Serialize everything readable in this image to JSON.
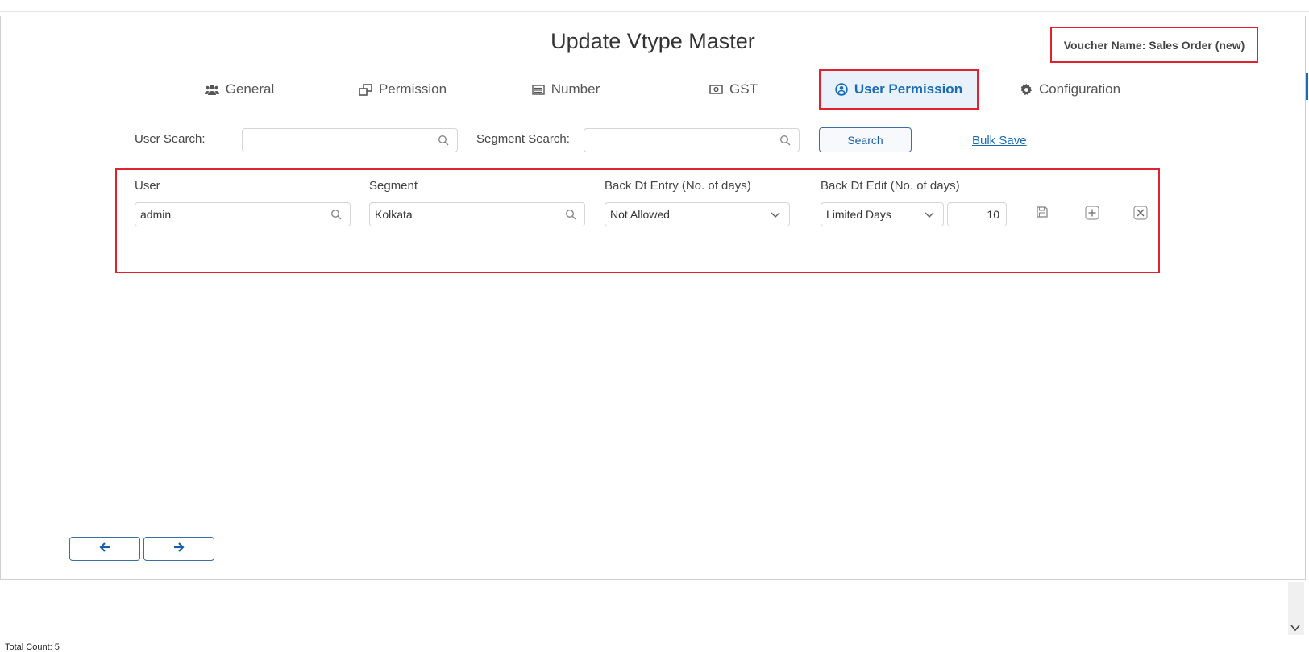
{
  "header": {
    "title": "Update Vtype Master",
    "voucher_name": "Voucher Name: Sales Order (new)"
  },
  "tabs": [
    {
      "label": "General",
      "icon": "users-icon"
    },
    {
      "label": "Permission",
      "icon": "windows-icon"
    },
    {
      "label": "Number",
      "icon": "list-icon"
    },
    {
      "label": "GST",
      "icon": "money-icon"
    },
    {
      "label": "User Permission",
      "icon": "user-circle-icon",
      "active": true
    },
    {
      "label": "Configuration",
      "icon": "gear-icon"
    }
  ],
  "search": {
    "user_label": "User Search:",
    "user_value": "",
    "segment_label": "Segment Search:",
    "segment_value": "",
    "search_button": "Search",
    "bulk_save": "Bulk Save"
  },
  "grid": {
    "headers": [
      "User",
      "Segment",
      "Back Dt Entry (No. of days)",
      "Back Dt Edit (No. of days)"
    ],
    "row": {
      "user": "admin",
      "segment": "Kolkata",
      "back_dt_entry": "Not Allowed",
      "back_dt_edit": "Limited Days",
      "days": "10"
    }
  },
  "footer": {
    "total_count": "Total Count: 5"
  },
  "colors": {
    "accent": "#1a6bb5",
    "highlight": "#e0212e"
  }
}
